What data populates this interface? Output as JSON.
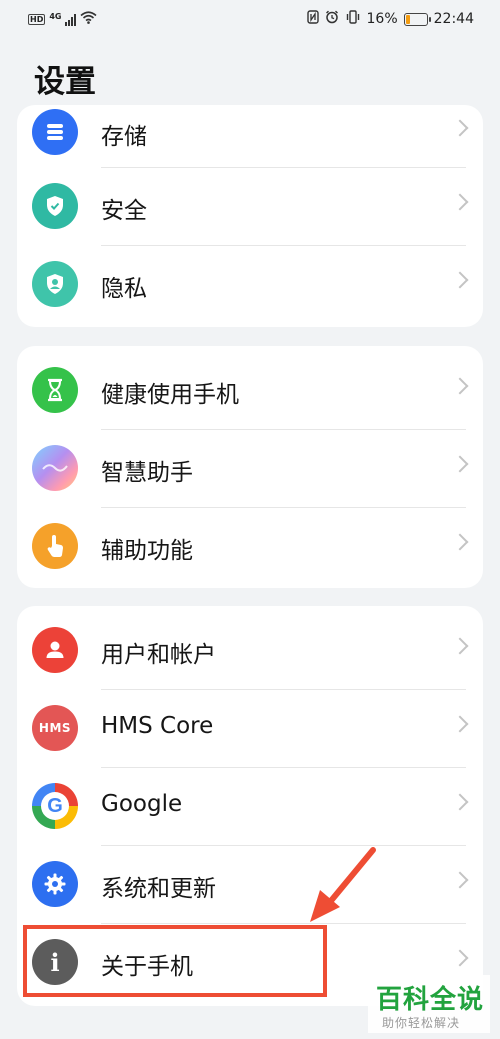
{
  "status_bar": {
    "left_badges": [
      "HD",
      "4G"
    ],
    "battery_percent": "16%",
    "time": "22:44",
    "icons": [
      "nfc-icon",
      "alarm-icon",
      "vibrate-icon"
    ]
  },
  "page": {
    "title": "设置"
  },
  "groups": [
    {
      "items": [
        {
          "label": "存储",
          "icon": "storage-icon",
          "color": "#2f6ff4"
        },
        {
          "label": "安全",
          "icon": "shield-icon",
          "color": "#2fb9a3"
        },
        {
          "label": "隐私",
          "icon": "privacy-icon",
          "color": "#3fc4aa"
        }
      ]
    },
    {
      "items": [
        {
          "label": "健康使用手机",
          "icon": "hourglass-icon",
          "color": "#35c24a"
        },
        {
          "label": "智慧助手",
          "icon": "assistant-icon",
          "color": "#b58ff0"
        },
        {
          "label": "辅助功能",
          "icon": "hand-icon",
          "color": "#f5a12a"
        }
      ]
    },
    {
      "items": [
        {
          "label": "用户和帐户",
          "icon": "user-icon",
          "color": "#ec4238"
        },
        {
          "label": "HMS Core",
          "icon": "hms-icon",
          "icon_text": "HMS",
          "color": "#e35655"
        },
        {
          "label": "Google",
          "icon": "google-icon",
          "icon_text": "G",
          "color": "#4285f4"
        },
        {
          "label": "系统和更新",
          "icon": "gear-icon",
          "color": "#2d6ff0"
        },
        {
          "label": "关于手机",
          "icon": "info-icon",
          "icon_text": "i",
          "color": "#5c5c5c"
        }
      ]
    }
  ],
  "annotation": {
    "highlight_color": "#ee4d34"
  },
  "watermark": {
    "main": "百科全说",
    "sub": "助你轻松解决"
  }
}
